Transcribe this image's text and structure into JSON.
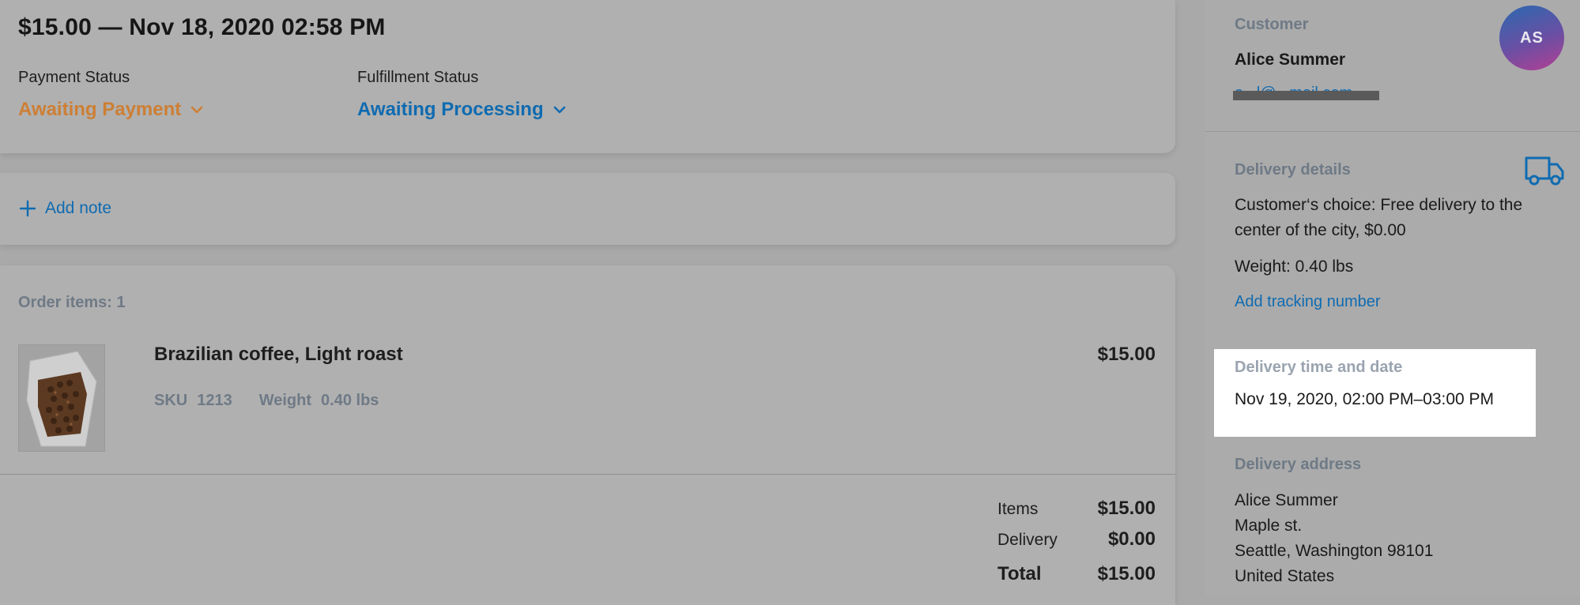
{
  "header": {
    "title": "$15.00 — Nov 18, 2020 02:58 PM",
    "payment_status_label": "Payment Status",
    "payment_status_value": "Awaiting Payment",
    "fulfillment_status_label": "Fulfillment Status",
    "fulfillment_status_value": "Awaiting Processing"
  },
  "note": {
    "add_label": "Add note"
  },
  "items": {
    "count_label": "Order items: 1",
    "list": [
      {
        "name": "Brazilian coffee, Light roast",
        "sku_label": "SKU",
        "sku": "1213",
        "weight_label": "Weight",
        "weight": "0.40 lbs",
        "price": "$15.00"
      }
    ],
    "summary": {
      "items_label": "Items",
      "items_value": "$15.00",
      "delivery_label": "Delivery",
      "delivery_value": "$0.00",
      "total_label": "Total",
      "total_value": "$15.00"
    }
  },
  "sidebar": {
    "customer": {
      "heading": "Customer",
      "name": "Alice Summer",
      "email": "a...l@...mail.com",
      "avatar_initials": "AS"
    },
    "delivery_details": {
      "heading": "Delivery details",
      "choice_line1": "Customer‘s choice: Free delivery to the",
      "choice_line2": "center of the city, $0.00",
      "weight": "Weight: 0.40 lbs",
      "tracking_link": "Add tracking number"
    },
    "delivery_time": {
      "heading": "Delivery time and date",
      "value": "Nov 19, 2020, 02:00 PM–03:00 PM"
    },
    "delivery_address": {
      "heading": "Delivery address",
      "line1": "Alice Summer",
      "line2": "Maple st.",
      "line3": "Seattle, Washington 98101",
      "line4": "United States"
    }
  },
  "colors": {
    "status_orange": "#cd7f35",
    "link_blue": "#0f6bb1",
    "muted_heading": "#6f7a86"
  }
}
